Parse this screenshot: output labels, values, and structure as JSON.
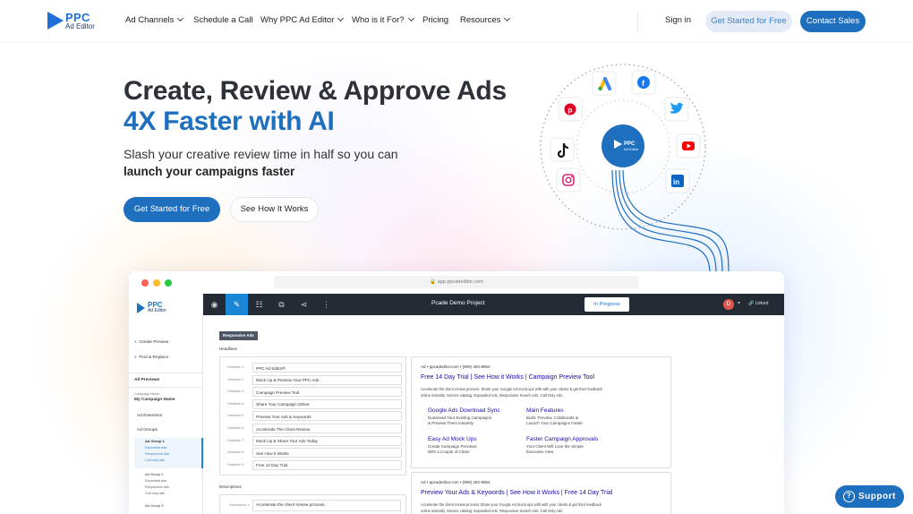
{
  "brand": {
    "logo_top": "PPC",
    "logo_bottom": "Ad Editor",
    "primary": "#1f6fbf",
    "light": "#e4ebf6"
  },
  "nav": {
    "items": [
      {
        "label": "Ad Channels",
        "dropdown": true
      },
      {
        "label": "Schedule a Call",
        "dropdown": false
      },
      {
        "label": "Why PPC Ad Editor",
        "dropdown": true
      },
      {
        "label": "Who is it For?",
        "dropdown": true
      },
      {
        "label": "Pricing",
        "dropdown": false
      },
      {
        "label": "Resources",
        "dropdown": true
      }
    ],
    "sign_in": "Sign in",
    "get_started": "Get Started for Free",
    "contact": "Contact Sales"
  },
  "hero": {
    "headline_1": "Create, Review & Approve Ads",
    "headline_2": "4X Faster with AI",
    "sub_1": "Slash your creative review time in half so you can",
    "sub_2": "launch your campaigns faster",
    "cta_primary": "Get Started for Free",
    "cta_secondary": "See How It Works"
  },
  "orbit": {
    "center_top": "PPC",
    "center_bottom": "Ad Editor",
    "icons": [
      "google-ads-icon",
      "facebook-icon",
      "pinterest-icon",
      "twitter-icon",
      "tiktok-icon",
      "youtube-icon",
      "instagram-icon",
      "linkedin-icon"
    ]
  },
  "mockup": {
    "url": "app.ppcadeditor.com",
    "project": "Pcade Demo Project",
    "status": "In Progress",
    "avatar": "D",
    "linked": "Linked",
    "sidebar": {
      "create_preview": "Create Preview",
      "find_replace": "Find & Replace",
      "all_previews": "All Previews",
      "campaign_name_label": "Campaign Name",
      "campaign_name": "My Campaign Name",
      "ad_extension": "Ad Extension",
      "ad_groups": "Ad Groups",
      "ad_group_1": "Ad Group 1",
      "ad_group_1_items": [
        "Expanded ads",
        "Responsive ads",
        "Call-only ads"
      ],
      "ad_group_2": "Ad Group 2",
      "ad_group_2_items": [
        "Expanded ads",
        "Responsive ads",
        "Call-only ads"
      ],
      "ad_group_3": "Ad Group 3"
    },
    "editor": {
      "tag": "Responsive Ads",
      "headlines_label": "Headlines",
      "headlines": [
        {
          "label": "Headline 1:",
          "text": "PPC Ad Editor®"
        },
        {
          "label": "Headline 2:",
          "text": "Mock Up & Preview Your PPC Ads"
        },
        {
          "label": "Headline 3:",
          "text": "Campaign Preview Tool"
        },
        {
          "label": "Headline 4:",
          "text": "Share Your Campaign Online"
        },
        {
          "label": "Headline 5:",
          "text": "Preview Your Ads & Keywords"
        },
        {
          "label": "Headline 6:",
          "text": "Accelerate The Client Review"
        },
        {
          "label": "Headline 7:",
          "text": "Mock Up & Share Your Ads Today"
        },
        {
          "label": "Headline 8:",
          "text": "See How It Works"
        },
        {
          "label": "Headline 9:",
          "text": "Free 14 Day Trial"
        }
      ],
      "descriptions_label": "Descriptions",
      "description_1_label": "Description 1:",
      "description_1": "Accelerate the client review process."
    },
    "preview_1": {
      "ad_line": "Ad  •  ppcadeditor.com  •  (909) 293-8864",
      "title": "Free 14 Day Trial | See How it Works | Campaign Preview Tool",
      "desc_1": "Accelerate the client review process. Share your Google Ad mock-ups with with your clients & get their feedback",
      "desc_2": "online instantly. Service catalog: Expanded Ads, Responsive Search Ads, Call Only Ads",
      "sitelinks": [
        {
          "title": "Google Ads Download Sync",
          "l1": "Download Your Existing Campaigns",
          "l2": "& Preview Them Instantly"
        },
        {
          "title": "Main Features",
          "l1": "Build, Preview, Collaborate &",
          "l2": "Launch Your Campaigns Faster"
        },
        {
          "title": "Easy Ad Mock Ups",
          "l1": "Create Campaign Previews",
          "l2": "With a Couple of Clicks"
        },
        {
          "title": "Faster Campaign Approvals",
          "l1": "Your Client Will Love the Simple",
          "l2": "Executive View"
        }
      ]
    },
    "preview_2": {
      "ad_line": "Ad  •  ppcadeditor.com  •  (909) 293-8864",
      "title": "Preview Your Ads & Keywords | See How it Works | Free 14 Day Trial",
      "desc_1": "Accelerate the client review process Share your Google Ad mock-ups with with your clients & get their feedback",
      "desc_2": "online instantly. Service catalog: Expanded Ads, Responsive Search Ads, Call Only Ads"
    }
  },
  "support": {
    "label": "Support"
  }
}
